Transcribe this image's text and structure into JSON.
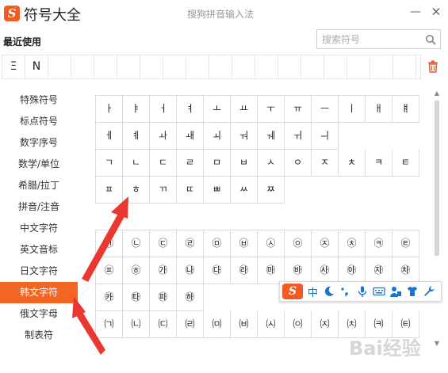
{
  "titlebar": {
    "app_title": "符号大全",
    "caption": "搜狗拼音输入法",
    "minimize": "—",
    "close": "✕"
  },
  "recent": {
    "title": "最近使用",
    "items": [
      "Ξ",
      "N",
      "",
      "",
      "",
      "",
      "",
      "",
      "",
      "",
      "",
      "",
      "",
      "",
      "",
      "",
      "",
      ""
    ]
  },
  "search": {
    "placeholder": "搜索符号"
  },
  "sidebar": {
    "items": [
      "特殊符号",
      "标点符号",
      "数字序号",
      "数学/单位",
      "希腊/拉丁",
      "拼音/注音",
      "中文字符",
      "英文音标",
      "日文字符",
      "韩文字符",
      "俄文字母",
      "制表符"
    ],
    "active_index": 9
  },
  "grid_a": [
    "ㅏ",
    "ㅑ",
    "ㅓ",
    "ㅕ",
    "ㅗ",
    "ㅛ",
    "ㅜ",
    "ㅠ",
    "ㅡ",
    "ㅣ",
    "ㅐ",
    "ㅒ",
    "ㅔ",
    "ㅖ",
    "ㅘ",
    "ㅙ",
    "ㅚ",
    "ㅝ",
    "ㅞ",
    "ㅟ",
    "ㅢ",
    "",
    "",
    "",
    "ㄱ",
    "ㄴ",
    "ㄷ",
    "ㄹ",
    "ㅁ",
    "ㅂ",
    "ㅅ",
    "ㅇ",
    "ㅈ",
    "ㅊ",
    "ㅋ",
    "ㅌ",
    "ㅍ",
    "ㅎ",
    "ㄲ",
    "ㄸ",
    "ㅃ",
    "ㅆ",
    "ㅉ",
    "",
    "",
    "",
    "",
    ""
  ],
  "grid_b": [
    "㉠",
    "㉡",
    "㉢",
    "㉣",
    "㉤",
    "㉥",
    "㉦",
    "㉧",
    "㉨",
    "㉩",
    "㉪",
    "㉫",
    "㉬",
    "㉭",
    "㉮",
    "㉯",
    "㉰",
    "㉱",
    "㉲",
    "㉳",
    "㉴",
    "㉵",
    "㉶",
    "㉷",
    "㉸",
    "㉹",
    "㉺",
    "㉻",
    "",
    "",
    "",
    "",
    "",
    "",
    "",
    "",
    "㈀",
    "㈁",
    "㈂",
    "㈃",
    "㈄",
    "㈅",
    "㈆",
    "㈇",
    "㈈",
    "㈉",
    "㈊",
    "㈋"
  ],
  "ime": {
    "mode": "中"
  },
  "watermark": "Bai经验",
  "colors": {
    "accent": "#f26522",
    "ime_blue": "#1b74d1",
    "arrow_red": "#e8382f"
  }
}
